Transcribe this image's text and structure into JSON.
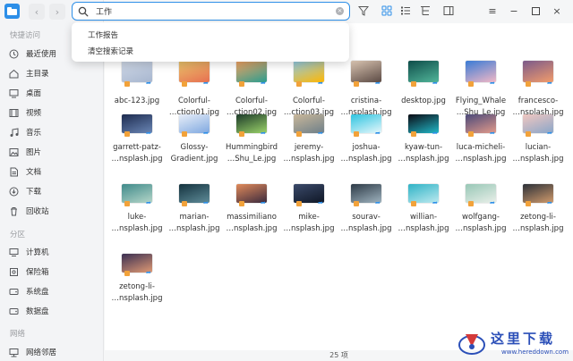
{
  "window": {
    "title": ""
  },
  "sidebar": {
    "quick_title": "快捷访问",
    "quick_items": [
      {
        "label": "最近使用",
        "icon": "clock-icon"
      },
      {
        "label": "主目录",
        "icon": "home-icon"
      },
      {
        "label": "桌面",
        "icon": "desktop-icon"
      },
      {
        "label": "视频",
        "icon": "video-icon"
      },
      {
        "label": "音乐",
        "icon": "music-icon"
      },
      {
        "label": "图片",
        "icon": "picture-icon"
      },
      {
        "label": "文档",
        "icon": "document-icon"
      },
      {
        "label": "下载",
        "icon": "download-icon"
      },
      {
        "label": "回收站",
        "icon": "trash-icon"
      }
    ],
    "partition_title": "分区",
    "partition_items": [
      {
        "label": "计算机",
        "icon": "computer-icon"
      },
      {
        "label": "保险箱",
        "icon": "safe-icon"
      },
      {
        "label": "系统盘",
        "icon": "disk-icon"
      },
      {
        "label": "数据盘",
        "icon": "disk-icon"
      }
    ],
    "network_title": "网络",
    "network_items": [
      {
        "label": "网络邻居",
        "icon": "network-icon"
      }
    ]
  },
  "search": {
    "value": "工作",
    "placeholder": ""
  },
  "dropdown": {
    "items": [
      "工作报告",
      "清空搜索记录"
    ]
  },
  "files": [
    {
      "name": "abc-123.jpg",
      "c1": "#cfd8e6",
      "c2": "#a7b6cf"
    },
    {
      "name": "Colorful-\n…ction01.jpg",
      "c1": "#e9c46a",
      "c2": "#e76f51"
    },
    {
      "name": "Colorful-\n…ction02.jpg",
      "c1": "#f4a261",
      "c2": "#2a9d8f"
    },
    {
      "name": "Colorful-\n…ction03.jpg",
      "c1": "#8ecae6",
      "c2": "#ffb703"
    },
    {
      "name": "cristina-\n…nsplash.jpg",
      "c1": "#d8c3b0",
      "c2": "#5b4a44"
    },
    {
      "name": "desktop.jpg",
      "c1": "#0e4d4a",
      "c2": "#52b69a"
    },
    {
      "name": "Flying_Whale\n…Shu_Le.jpg",
      "c1": "#3a7bd5",
      "c2": "#f2b8c6"
    },
    {
      "name": "francesco-\n…nsplash.jpg",
      "c1": "#7b5a8a",
      "c2": "#f29c6b"
    },
    {
      "name": "garrett-patz-\n…nsplash.jpg",
      "c1": "#1d2b4f",
      "c2": "#6a86b5"
    },
    {
      "name": "Glossy-\nGradient.jpg",
      "c1": "#e8eef8",
      "c2": "#7fa8e0"
    },
    {
      "name": "Hummingbird\n…Shu_Le.jpg",
      "c1": "#1d3b2a",
      "c2": "#9bd36a"
    },
    {
      "name": "jeremy-\n…nsplash.jpg",
      "c1": "#c9b79a",
      "c2": "#6e7f89"
    },
    {
      "name": "joshua-\n…nsplash.jpg",
      "c1": "#2ec4e0",
      "c2": "#e7f7fb"
    },
    {
      "name": "kyaw-tun-\n…nsplash.jpg",
      "c1": "#0b0b14",
      "c2": "#21b8c8"
    },
    {
      "name": "luca-micheli-\n…nsplash.jpg",
      "c1": "#4b4a7a",
      "c2": "#e29a8a"
    },
    {
      "name": "lucian-\n…nsplash.jpg",
      "c1": "#f1c7c0",
      "c2": "#8aa6c9"
    },
    {
      "name": "luke-\n…nsplash.jpg",
      "c1": "#3f8a8a",
      "c2": "#b5d6c9"
    },
    {
      "name": "marian-\n…nsplash.jpg",
      "c1": "#14323e",
      "c2": "#5f8c99"
    },
    {
      "name": "massimiliano\n…nsplash.jpg",
      "c1": "#e08a5a",
      "c2": "#3a2a3e"
    },
    {
      "name": "mike-\n…nsplash.jpg",
      "c1": "#3b4a6a",
      "c2": "#0f1726"
    },
    {
      "name": "sourav-\n…nsplash.jpg",
      "c1": "#2d3a46",
      "c2": "#9fb3bf"
    },
    {
      "name": "willian-\n…nsplash.jpg",
      "c1": "#2fb3c6",
      "c2": "#bde9ef"
    },
    {
      "name": "wolfgang-\n…nsplash.jpg",
      "c1": "#98c7b6",
      "c2": "#e9efe9"
    },
    {
      "name": "zetong-li-\n…nsplash.jpg",
      "c1": "#2b3038",
      "c2": "#d19b6c"
    },
    {
      "name": "zetong-li-\n…nsplash.jpg",
      "c1": "#3a2f52",
      "c2": "#e09a74"
    }
  ],
  "status": {
    "count": "25 项"
  },
  "watermark": {
    "text": "这里下载",
    "url": "www.hereddown.com"
  }
}
